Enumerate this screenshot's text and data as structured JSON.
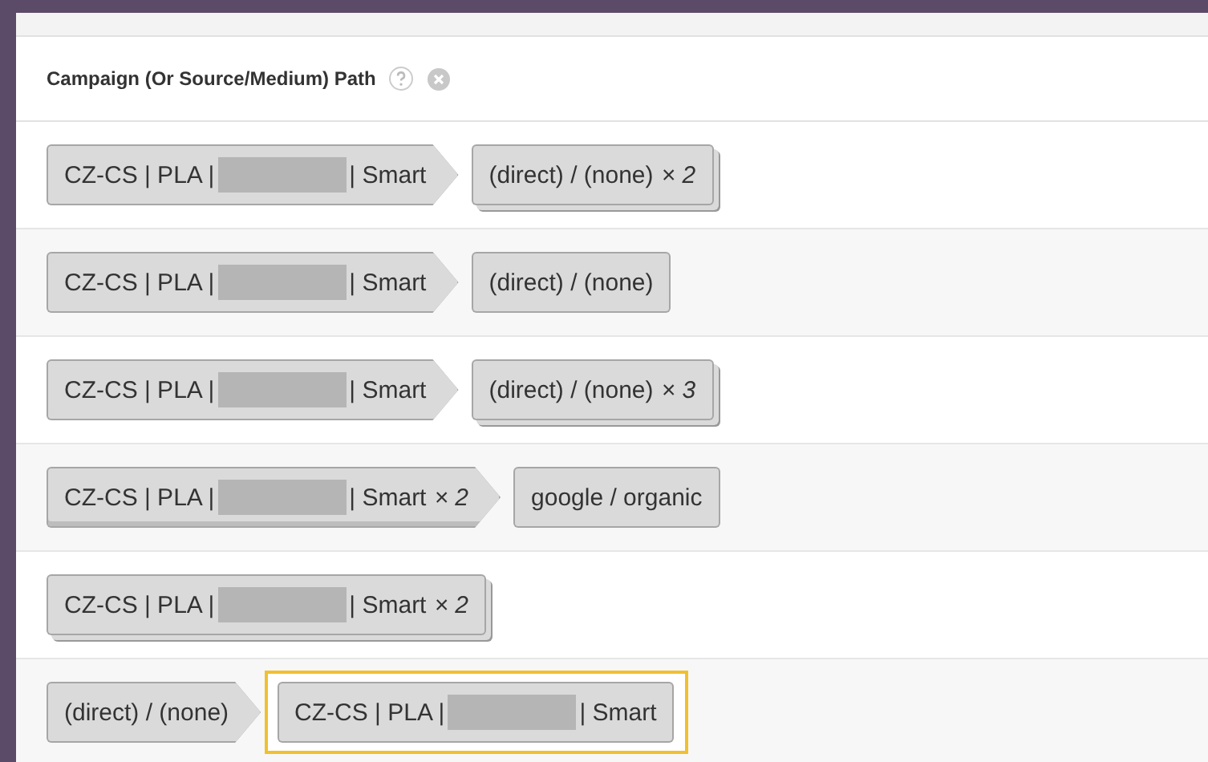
{
  "header": {
    "title": "Campaign (Or Source/Medium) Path"
  },
  "rows": [
    {
      "steps": [
        {
          "kind": "redacted",
          "before": "CZ-CS | PLA |",
          "after": "| Smart",
          "stacked": false,
          "highlighted": false
        },
        {
          "kind": "plain",
          "text": "(direct) / (none)",
          "count": "× 2",
          "stacked": true,
          "highlighted": false
        }
      ]
    },
    {
      "steps": [
        {
          "kind": "redacted",
          "before": "CZ-CS | PLA |",
          "after": "| Smart",
          "stacked": false,
          "highlighted": false
        },
        {
          "kind": "plain",
          "text": "(direct) / (none)",
          "stacked": false,
          "highlighted": false
        }
      ]
    },
    {
      "steps": [
        {
          "kind": "redacted",
          "before": "CZ-CS | PLA |",
          "after": "| Smart",
          "stacked": false,
          "highlighted": false
        },
        {
          "kind": "plain",
          "text": "(direct) / (none)",
          "count": "× 3",
          "stacked": true,
          "highlighted": false
        }
      ]
    },
    {
      "steps": [
        {
          "kind": "redacted",
          "before": "CZ-CS | PLA |",
          "after": "| Smart",
          "count": "× 2",
          "stacked": true,
          "highlighted": false
        },
        {
          "kind": "plain",
          "text": "google / organic",
          "stacked": false,
          "highlighted": false
        }
      ]
    },
    {
      "steps": [
        {
          "kind": "redacted",
          "before": "CZ-CS | PLA |",
          "after": "| Smart",
          "count": "× 2",
          "stacked": true,
          "highlighted": false
        }
      ]
    },
    {
      "steps": [
        {
          "kind": "plain",
          "text": "(direct) / (none)",
          "stacked": false,
          "highlighted": false
        },
        {
          "kind": "redacted",
          "before": "CZ-CS | PLA |",
          "after": "| Smart",
          "stacked": false,
          "highlighted": true
        }
      ]
    }
  ]
}
